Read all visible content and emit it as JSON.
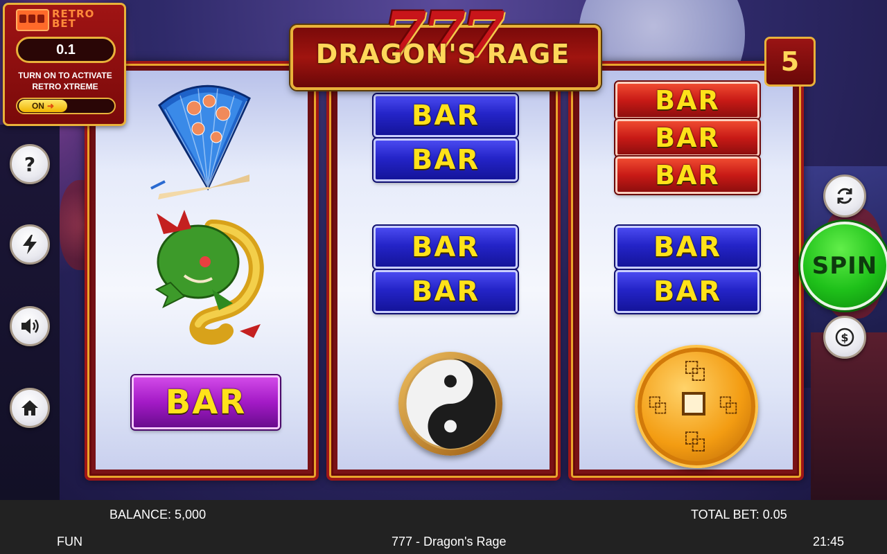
{
  "retro_bet": {
    "logo": "RETRO BET",
    "value": "0.1",
    "description": "TURN ON TO ACTIVATE RETRO XTREME",
    "toggle_label": "ON"
  },
  "title": {
    "number": "777",
    "name": "DRAGON'S RAGE"
  },
  "lines": "5",
  "reels": [
    {
      "symbols": [
        "fan",
        "dragon",
        "BAR"
      ]
    },
    {
      "symbols": [
        "BAR",
        "BAR",
        "BAR",
        "BAR",
        "yin-yang"
      ]
    },
    {
      "symbols": [
        "BAR",
        "BAR",
        "BAR",
        "BAR",
        "BAR",
        "coin"
      ]
    }
  ],
  "controls": {
    "spin_label": "SPIN",
    "left_icons": [
      "help-icon",
      "lightning-icon",
      "sound-icon",
      "home-icon"
    ],
    "right_icons": [
      "autoplay-icon",
      "bet-icon"
    ]
  },
  "bottom_bar": {
    "balance": "BALANCE: 5,000",
    "total_bet": "TOTAL BET: 0.05",
    "mode": "FUN",
    "game_name": "777 - Dragon's Rage",
    "time": "21:45"
  },
  "colors": {
    "reel_frame": "#a01616",
    "gold": "#e9b23a",
    "spin_green": "#1fc11a",
    "bar_blue": "#2424c8",
    "bar_red": "#c81a16",
    "bar_purple": "#a31ac6",
    "bar_text": "#ffe21a"
  }
}
